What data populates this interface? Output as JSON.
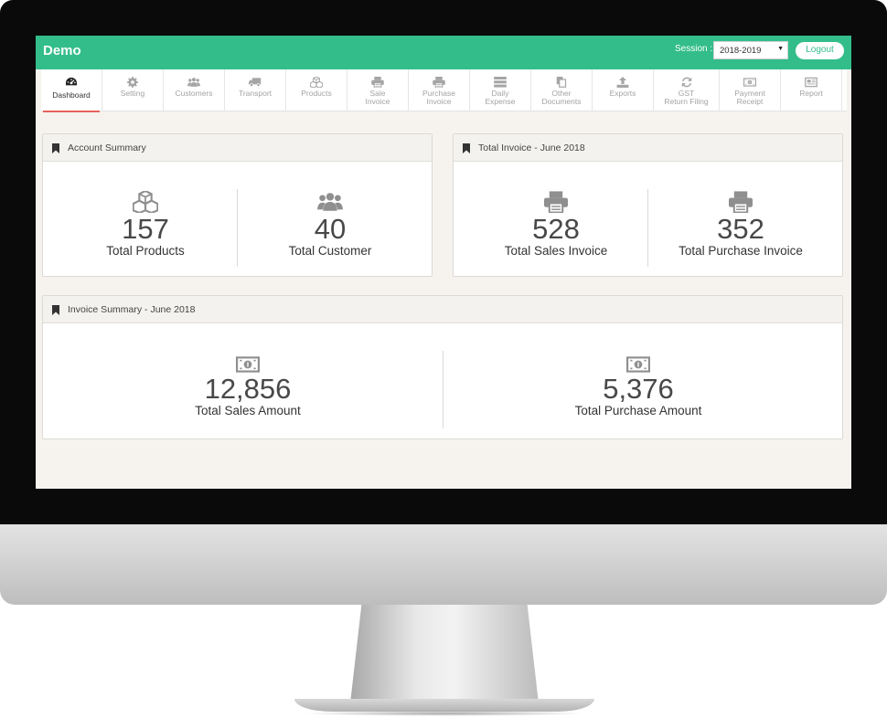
{
  "app": {
    "title": "Demo"
  },
  "session": {
    "label": "Session :",
    "value": "2018-2019"
  },
  "logout_label": "Logout",
  "nav": [
    {
      "label": "Dashboard",
      "icon": "dashboard-icon",
      "active": true
    },
    {
      "label": "Setting",
      "icon": "gear-icon"
    },
    {
      "label": "Customers",
      "icon": "users-icon"
    },
    {
      "label": "Transport",
      "icon": "truck-icon"
    },
    {
      "label": "Products",
      "icon": "cubes-icon"
    },
    {
      "label": "Sale\nInvoice",
      "icon": "printer-icon"
    },
    {
      "label": "Purchase\nInvoice",
      "icon": "printer-icon"
    },
    {
      "label": "Daily\nExpense",
      "icon": "server-icon"
    },
    {
      "label": "Other\nDocuments",
      "icon": "files-icon"
    },
    {
      "label": "Exports",
      "icon": "upload-icon"
    },
    {
      "label": "GST\nReturn Filing",
      "icon": "refresh-icon"
    },
    {
      "label": "Payment\nReceipt",
      "icon": "money-icon"
    },
    {
      "label": "Report",
      "icon": "newspaper-icon"
    }
  ],
  "account_summary": {
    "title": "Account Summary",
    "products": {
      "value": "157",
      "label": "Total Products"
    },
    "customers": {
      "value": "40",
      "label": "Total Customer"
    }
  },
  "total_invoice": {
    "title": "Total Invoice - June 2018",
    "sales": {
      "value": "528",
      "label": "Total Sales Invoice"
    },
    "purchase": {
      "value": "352",
      "label": "Total Purchase Invoice"
    }
  },
  "invoice_summary": {
    "title": "Invoice Summary - June 2018",
    "sales": {
      "value": "12,856",
      "label": "Total Sales Amount"
    },
    "purchase": {
      "value": "5,376",
      "label": "Total Purchase Amount"
    }
  },
  "colors": {
    "header": "#33bd8b",
    "active_underline": "#e8615b",
    "content_bg": "#f6f3ee"
  }
}
